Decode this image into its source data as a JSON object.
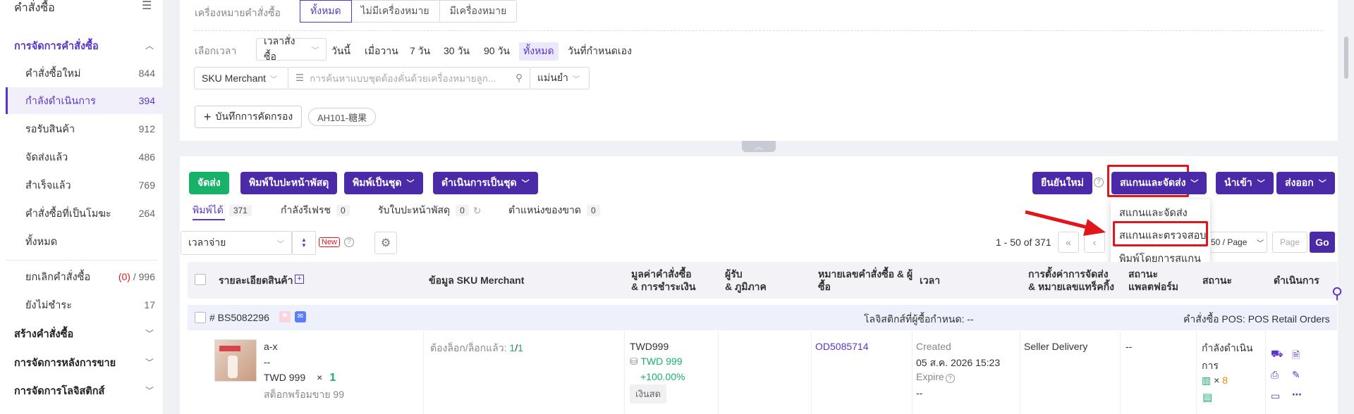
{
  "sidebar": {
    "title": "คำสั่งซื้อ",
    "section_order_mgmt": "การจัดการคำสั่งซื้อ",
    "items": [
      {
        "label": "คำสั่งซื้อใหม่",
        "count": "844"
      },
      {
        "label": "กำลังดำเนินการ",
        "count": "394"
      },
      {
        "label": "รอรับสินค้า",
        "count": "912"
      },
      {
        "label": "จัดส่งแล้ว",
        "count": "486"
      },
      {
        "label": "สำเร็จแล้ว",
        "count": "769"
      },
      {
        "label": "คำสั่งซื้อที่เป็นโมฆะ",
        "count": "264"
      },
      {
        "label": "ทั้งหมด",
        "count": ""
      }
    ],
    "cancel_item": {
      "label": "ยกเลิกคำสั่งซื้อ",
      "count_red": "(0)",
      "count_rest": "/ 996"
    },
    "unpaid_item": {
      "label": "ยังไม่ชำระ",
      "count": "17"
    },
    "section_create": "สร้างคำสั่งซื้อ",
    "section_after_sales": "การจัดการหลังการขาย",
    "section_logistics": "การจัดการโลจิสติกส์"
  },
  "filters": {
    "marker_label": "เครื่องหมายคำสั่งซื้อ",
    "marker_options": [
      "ทั้งหมด",
      "ไม่มีเครื่องหมาย",
      "มีเครื่องหมาย"
    ],
    "time_label": "เลือกเวลา",
    "time_type": "เวลาสั่งซื้อ",
    "time_options": [
      "วันนี้",
      "เมื่อวาน",
      "7 วัน",
      "30 วัน",
      "90 วัน",
      "ทั้งหมด",
      "วันที่กำหนดเอง"
    ],
    "sku_select": "SKU Merchant",
    "search_placeholder": "การค้นหาแบบชุดต้องคั่นด้วยเครื่องหมายลูก...",
    "match_select": "แม่นยำ",
    "save_filter": "บันทึกการคัดกรอง",
    "saved_tag": "AH101-糖果",
    "collapse_icon": "chevron-up-icon"
  },
  "actions": {
    "ship": "จัดส่ง",
    "print_label": "พิมพ์ใบปะหน้าพัสดุ",
    "print_batch": "พิมพ์เป็นชุด",
    "batch_process": "ดำเนินการเป็นชุด",
    "confirm_again": "ยืนยันใหม่",
    "scan_ship": "สแกนและจัดส่ง",
    "import": "นำเข้า",
    "export": "ส่งออก"
  },
  "scan_menu": [
    "สแกนและจัดส่ง",
    "สแกนและตรวจสอบ",
    "พิมพ์โดยการสแกน"
  ],
  "subtabs": [
    {
      "label": "พิมพ์ได้",
      "count": "371"
    },
    {
      "label": "กำลังรีเฟรช",
      "count": "0"
    },
    {
      "label": "รับใบปะหน้าพัสดุ",
      "count": "0"
    },
    {
      "label": "ตำแหน่งของขาด",
      "count": "0"
    }
  ],
  "toolbar": {
    "sort_select": "เวลาจ่าย",
    "new_badge": "New",
    "range_text": "1 - 50 of 371",
    "page_size": "50 / Page",
    "page_placeholder": "Page",
    "go": "Go"
  },
  "table": {
    "headers": {
      "product": "รายละเอียดสินค้า",
      "sku": "ข้อมูล SKU Merchant",
      "value_l1": "มูลค่าคำสั่งซื้อ",
      "value_l2": "& การชำระเงิน",
      "receiver_l1": "ผู้รับ",
      "receiver_l2": "& ภูมิภาค",
      "orderno_l1": "หมายเลขคำสั่งซื้อ & ผู้",
      "orderno_l2": "ซื้อ",
      "time": "เวลา",
      "shipping_l1": "การตั้งค่าการจัดส่ง",
      "shipping_l2": "& หมายเลขแทร็คกิ้ง",
      "platform_l1": "สถานะ",
      "platform_l2": "แพลตฟอร์ม",
      "status": "สถานะ",
      "action": "ดำเนินการ"
    },
    "order": {
      "id": "# BS5082296",
      "logistics": "โลจิสติกส์ที่ผู้ซื้อกำหนด: --",
      "source": "คำสั่งซื้อ POS: POS Retail Orders",
      "product_name": "a-x",
      "product_variant": "--",
      "price": "TWD 999",
      "times": "×",
      "qty": "1",
      "stock": "สต็อกพร้อมขาย 99",
      "lock_label": "ต้องล็อก/ล็อกแล้ว:",
      "lock_need": "1",
      "lock_done": "1",
      "value": "TWD999",
      "paid": "TWD 999",
      "percent": "+100.00%",
      "pay_method": "เงินสด",
      "order_no": "OD5085714",
      "created_label": "Created",
      "created_time": "05 ส.ค. 2026 15:23",
      "expire_label": "Expire",
      "expire_value": "--",
      "shipping": "Seller Delivery",
      "platform_status": "--",
      "status_l1": "กำลังดำเนิน",
      "status_l2": "การ",
      "barcode_times": "×",
      "barcode_count": "8"
    }
  },
  "colors": {
    "accent": "#4b2aa8",
    "green": "#17b26a",
    "red": "#e0161b"
  }
}
